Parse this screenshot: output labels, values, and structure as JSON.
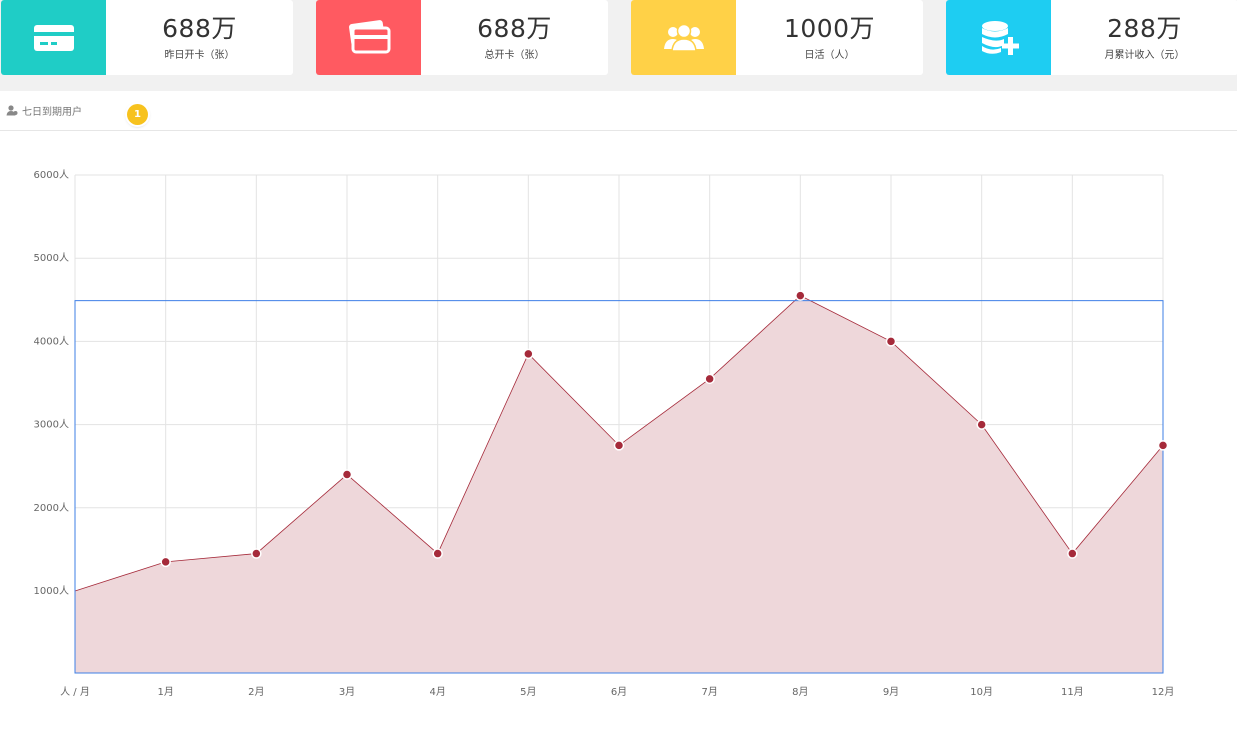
{
  "stats": [
    {
      "value": "688万",
      "label": "昨日开卡（张）",
      "color": "#1fcdc6",
      "icon": "card-icon"
    },
    {
      "value": "688万",
      "label": "总开卡（张）",
      "color": "#ff5a61",
      "icon": "cards-icon"
    },
    {
      "value": "1000万",
      "label": "日活（人）",
      "color": "#ffd147",
      "icon": "users-icon"
    },
    {
      "value": "288万",
      "label": "月累计收入（元）",
      "color": "#1ecdf2",
      "icon": "coins-add-icon"
    }
  ],
  "panel": {
    "title": "七日到期用户",
    "title_icon": "user-icon",
    "badge": "1"
  },
  "chart_data": {
    "type": "area",
    "x_categories": [
      "人 / 月",
      "1月",
      "2月",
      "3月",
      "4月",
      "5月",
      "6月",
      "7月",
      "8月",
      "9月",
      "10月",
      "11月",
      "12月"
    ],
    "values": [
      1000,
      1350,
      1450,
      2400,
      1450,
      3850,
      2750,
      3550,
      4550,
      4000,
      3000,
      1450,
      2750
    ],
    "y_ticks": [
      "1000人",
      "2000人",
      "3000人",
      "4000人",
      "5000人",
      "6000人"
    ],
    "y_tick_values": [
      1000,
      2000,
      3000,
      4000,
      5000,
      6000
    ],
    "ylim": [
      0,
      6000
    ],
    "grid": true,
    "line_color": "#a52a3a",
    "fill_color": "#eed7da",
    "highlight_box_color": "#3d7fe6"
  }
}
